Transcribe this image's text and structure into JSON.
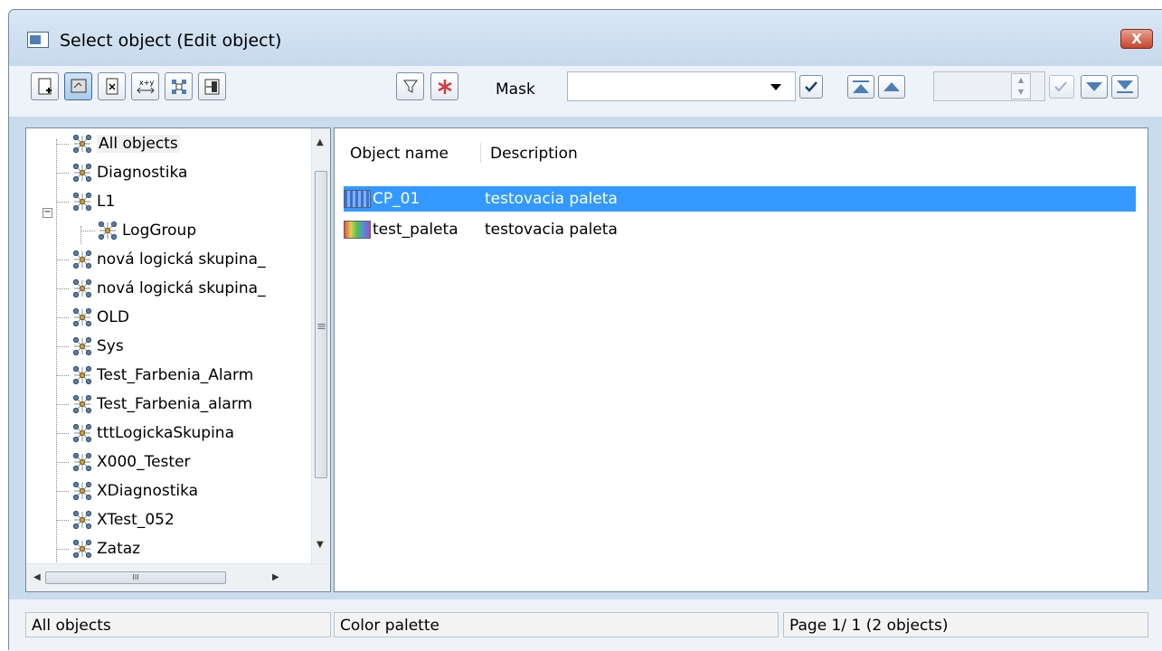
{
  "window": {
    "title": "Select object (Edit object)",
    "close_glyph": "X"
  },
  "toolbar": {
    "left_buttons": [
      "new-object-icon",
      "edit-object-icon",
      "delete-object-icon",
      "rename-object-icon",
      "logical-group-icon",
      "export-icon"
    ],
    "filter_buttons": [
      "filter-icon",
      "clear-filter-icon"
    ],
    "mask_label": "Mask",
    "mask_value": "",
    "page_value": ""
  },
  "tree": {
    "items": [
      {
        "label": "All objects"
      },
      {
        "label": "Diagnostika"
      },
      {
        "label": "L1"
      },
      {
        "label": "LogGroup"
      },
      {
        "label": "nová logická skupina_"
      },
      {
        "label": "nová logická skupina_"
      },
      {
        "label": "OLD"
      },
      {
        "label": "Sys"
      },
      {
        "label": "Test_Farbenia_Alarm"
      },
      {
        "label": "Test_Farbenia_alarm"
      },
      {
        "label": "tttLogickaSkupina"
      },
      {
        "label": "X000_Tester"
      },
      {
        "label": "XDiagnostika"
      },
      {
        "label": "XTest_052"
      },
      {
        "label": "Zataz"
      }
    ],
    "hscroll_grip": "III"
  },
  "table": {
    "columns": [
      "Object name",
      "Description"
    ],
    "rows": [
      {
        "name": "CP_01",
        "description": "testovacia paleta",
        "selected": true
      },
      {
        "name": "test_paleta",
        "description": "testovacia paleta",
        "selected": false
      }
    ]
  },
  "status": {
    "left": "All objects",
    "middle": "Color palette",
    "right": "Page  1/ 1  (2 objects)"
  },
  "colors": {
    "selection": "#3399ff",
    "window_frame": "#c9dcee"
  }
}
